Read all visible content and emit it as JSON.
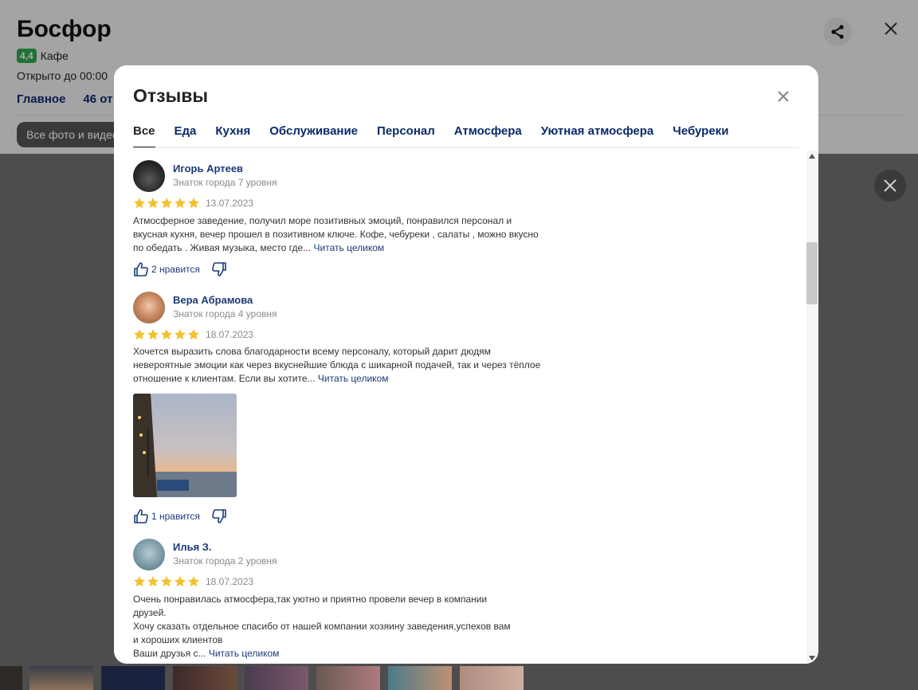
{
  "place": {
    "name": "Босфор",
    "rating": "4,4",
    "category": "Кафе",
    "hours": "Открыто до 00:00",
    "tabs": [
      "Главное",
      "46 от"
    ],
    "photo_button": "Все фото и видео"
  },
  "modal": {
    "title": "Отзывы",
    "tabs": [
      "Все",
      "Еда",
      "Кухня",
      "Обслуживание",
      "Персонал",
      "Атмосфера",
      "Уютная атмосфера",
      "Чебуреки"
    ],
    "active_tab": "Все"
  },
  "reviews": [
    {
      "author": "Игорь Артеев",
      "level": "Знаток города 7 уровня",
      "rating": 5,
      "date": "13.07.2023",
      "text": "Атмосферное заведение, получил море позитивных эмоций, понравился персонал и вкусная кухня, вечер прошел в позитивном ключе. Кофе, чебуреки , салаты , можно вкусно по обедать . Живая музыка, место где...",
      "read_more": "Читать целиком",
      "likes": "2 нравится"
    },
    {
      "author": "Вера Абрамова",
      "level": "Знаток города 4 уровня",
      "rating": 5,
      "date": "18.07.2023",
      "text": "Хочется выразить слова благодарности всему персоналу, который дарит дюдям невероятные эмоции как через вкуснейшие блюда с шикарной подачей, так и через тёплое отношение к клиентам. Если вы хотите...",
      "read_more": "Читать целиком",
      "likes": "1 нравится"
    },
    {
      "author": "Илья З.",
      "level": "Знаток города 2 уровня",
      "rating": 5,
      "date": "18.07.2023",
      "text_lines": [
        "Очень понравилась атмосфера,так уютно и приятно провели вечер в компании",
        "друзей.",
        "Хочу сказать отдельное спасибо от нашей компании хозяину заведения,успехов вам",
        "и хороших клиентов",
        "Ваши друзья с..."
      ],
      "read_more": "Читать целиком"
    }
  ],
  "colors": {
    "link": "#1c3a7a",
    "star": "#f2c12e",
    "rating_badge": "#2fa84f"
  }
}
